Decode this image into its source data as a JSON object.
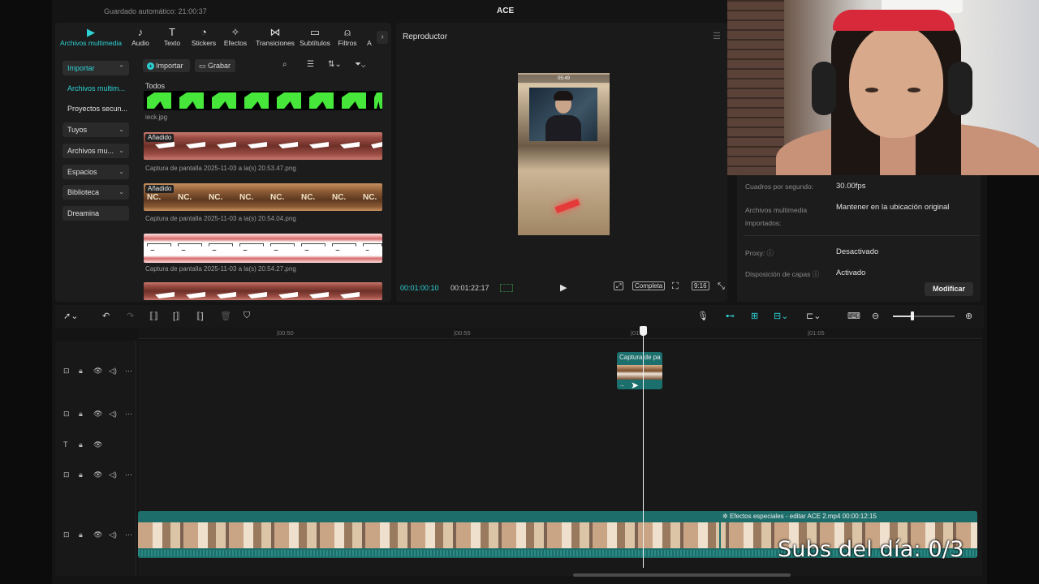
{
  "header": {
    "autosave": "Guardado automático: 21:00:37",
    "project_title": "ACE"
  },
  "tool_tabs": [
    {
      "label": "Archivos multimedia",
      "icon": "media-icon",
      "glyph": "▶",
      "active": true
    },
    {
      "label": "Audio",
      "icon": "audio-icon",
      "glyph": "♪"
    },
    {
      "label": "Texto",
      "icon": "text-icon",
      "glyph": "T"
    },
    {
      "label": "Stickers",
      "icon": "sticker-icon",
      "glyph": "◔"
    },
    {
      "label": "Efectos",
      "icon": "effects-icon",
      "glyph": "✧"
    },
    {
      "label": "Transiciones",
      "icon": "transitions-icon",
      "glyph": "⋈"
    },
    {
      "label": "Subtítulos",
      "icon": "subtitles-icon",
      "glyph": "▭"
    },
    {
      "label": "Filtros",
      "icon": "filters-icon",
      "glyph": "⍝"
    },
    {
      "label": "A",
      "icon": "more-tab-icon",
      "glyph": ""
    }
  ],
  "sidebar": {
    "items": [
      {
        "label": "Importar",
        "style": "box-active",
        "chevron": "⌃"
      },
      {
        "label": "Archivos multim...",
        "style": "active-text"
      },
      {
        "label": "Proyectos secun...",
        "style": "plain"
      },
      {
        "label": "Tuyos",
        "style": "box",
        "chevron": "⌄"
      },
      {
        "label": "Archivos mu...",
        "style": "box",
        "chevron": "⌄"
      },
      {
        "label": "Espacios",
        "style": "box",
        "chevron": "⌄"
      },
      {
        "label": "Biblioteca",
        "style": "box",
        "chevron": "⌄"
      },
      {
        "label": "Dreamina",
        "style": "box"
      }
    ]
  },
  "media": {
    "import_label": "Importar",
    "record_label": "Grabar",
    "all_label": "Todos",
    "added_badge": "Añadido",
    "files": [
      {
        "name": "ieck.jpg",
        "thumb": "green"
      },
      {
        "name": "Captura de pantalla 2025-11-03 a la(s) 20.53.47.png",
        "thumb": "pink",
        "added": true
      },
      {
        "name": "Captura de pantalla 2025-11-03 a la(s) 20.54.04.png",
        "thumb": "tan",
        "added": true,
        "thumb_text": "NC."
      },
      {
        "name": "Captura de pantalla 2025-11-03 a la(s) 20.54.27.png",
        "thumb": "gun"
      }
    ]
  },
  "player": {
    "title": "Reproductor",
    "current_time": "00:01:00:10",
    "total_time": "00:01:22:17",
    "full_label": "Completa",
    "ratio_label": "9:16",
    "video_hud": "05:49"
  },
  "properties": {
    "rows": [
      {
        "label": "Cuadros por segundo:",
        "value": "30.00fps"
      },
      {
        "label": "Archivos multimedia importados:",
        "value": "Mantener en la ubicación original"
      },
      {
        "label": "Proxy:",
        "value": "Desactivado"
      },
      {
        "label": "Disposición de capas",
        "value": "Activado"
      }
    ],
    "modify_label": "Modificar"
  },
  "timeline": {
    "ruler_ticks": [
      "00:50",
      "00:55",
      "01:00",
      "01:05"
    ],
    "small_clip_title": "Captura de pa",
    "main_clip_info": "Efectos especiales - editar   ACE 2.mp4   00:00:12:15",
    "zoom_level": 0.32
  },
  "overlay": {
    "subs_text": "Subs del día: 0/3"
  },
  "colors": {
    "accent": "#2fd3d6",
    "clip": "#1d6e6a",
    "panel": "#1c1c1c"
  }
}
